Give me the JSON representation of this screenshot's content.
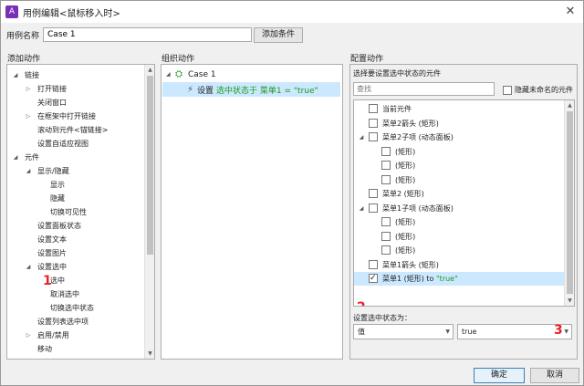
{
  "window": {
    "title": "用例编辑<鼠标移入时>",
    "close": "✕"
  },
  "case_name": {
    "label": "用例名称",
    "value": "Case 1"
  },
  "add_condition": "添加条件",
  "sections": {
    "add_action": "添加动作",
    "organize_action": "组织动作",
    "configure_action": "配置动作"
  },
  "left_tree": [
    {
      "label": "链接",
      "level": 0,
      "toggle": "◢"
    },
    {
      "label": "打开链接",
      "level": 1,
      "toggle": "▷"
    },
    {
      "label": "关闭窗口",
      "level": 1,
      "toggle": ""
    },
    {
      "label": "在框架中打开链接",
      "level": 1,
      "toggle": "▷"
    },
    {
      "label": "滚动到元件<锚链接>",
      "level": 1,
      "toggle": ""
    },
    {
      "label": "设置自适应视图",
      "level": 1,
      "toggle": ""
    },
    {
      "label": "元件",
      "level": 0,
      "toggle": "◢"
    },
    {
      "label": "显示/隐藏",
      "level": 1,
      "toggle": "◢"
    },
    {
      "label": "显示",
      "level": 2,
      "toggle": ""
    },
    {
      "label": "隐藏",
      "level": 2,
      "toggle": ""
    },
    {
      "label": "切换可见性",
      "level": 2,
      "toggle": ""
    },
    {
      "label": "设置面板状态",
      "level": 1,
      "toggle": ""
    },
    {
      "label": "设置文本",
      "level": 1,
      "toggle": ""
    },
    {
      "label": "设置图片",
      "level": 1,
      "toggle": ""
    },
    {
      "label": "设置选中",
      "level": 1,
      "toggle": "◢"
    },
    {
      "label": "选中",
      "level": 2,
      "toggle": ""
    },
    {
      "label": "取消选中",
      "level": 2,
      "toggle": ""
    },
    {
      "label": "切换选中状态",
      "level": 2,
      "toggle": ""
    },
    {
      "label": "设置列表选中项",
      "level": 1,
      "toggle": ""
    },
    {
      "label": "启用/禁用",
      "level": 1,
      "toggle": "▷"
    },
    {
      "label": "移动",
      "level": 1,
      "toggle": ""
    }
  ],
  "middle": {
    "case_label": "Case 1",
    "action_prefix": "设置",
    "action_detail": "选中状态于 菜单1 = \"true\""
  },
  "right": {
    "choose_label": "选择要设置选中状态的元件",
    "search_placeholder": "查找",
    "hide_unnamed": "隐藏未命名的元件",
    "items": [
      {
        "label": "当前元件",
        "level": 1,
        "toggle": "",
        "checked": false,
        "selected": false
      },
      {
        "label": "菜单2箭头 (矩形)",
        "level": 1,
        "toggle": "",
        "checked": false,
        "selected": false
      },
      {
        "label": "菜单2子项 (动态面板)",
        "level": 1,
        "toggle": "◢",
        "checked": false,
        "selected": false
      },
      {
        "label": "(矩形)",
        "level": 2,
        "toggle": "",
        "checked": false,
        "selected": false
      },
      {
        "label": "(矩形)",
        "level": 2,
        "toggle": "",
        "checked": false,
        "selected": false
      },
      {
        "label": "(矩形)",
        "level": 2,
        "toggle": "",
        "checked": false,
        "selected": false
      },
      {
        "label": "菜单2 (矩形)",
        "level": 1,
        "toggle": "",
        "checked": false,
        "selected": false
      },
      {
        "label": "菜单1子项 (动态面板)",
        "level": 1,
        "toggle": "◢",
        "checked": false,
        "selected": false
      },
      {
        "label": "(矩形)",
        "level": 2,
        "toggle": "",
        "checked": false,
        "selected": false
      },
      {
        "label": "(矩形)",
        "level": 2,
        "toggle": "",
        "checked": false,
        "selected": false
      },
      {
        "label": "(矩形)",
        "level": 2,
        "toggle": "",
        "checked": false,
        "selected": false
      },
      {
        "label": "菜单1箭头 (矩形)",
        "level": 1,
        "toggle": "",
        "checked": false,
        "selected": false
      },
      {
        "label": "菜单1 (矩形) to ",
        "value": "\"true\"",
        "level": 1,
        "toggle": "",
        "checked": true,
        "selected": true
      }
    ],
    "state_label": "设置选中状态为：",
    "combo1": "值",
    "combo2": "true"
  },
  "annotations": [
    "1",
    "2",
    "3"
  ],
  "buttons": {
    "ok": "确定",
    "cancel": "取消"
  },
  "colors": {
    "accent_green": "#1a9a1a",
    "annotation_red": "#e8232a",
    "selection": "#cce8ff"
  }
}
